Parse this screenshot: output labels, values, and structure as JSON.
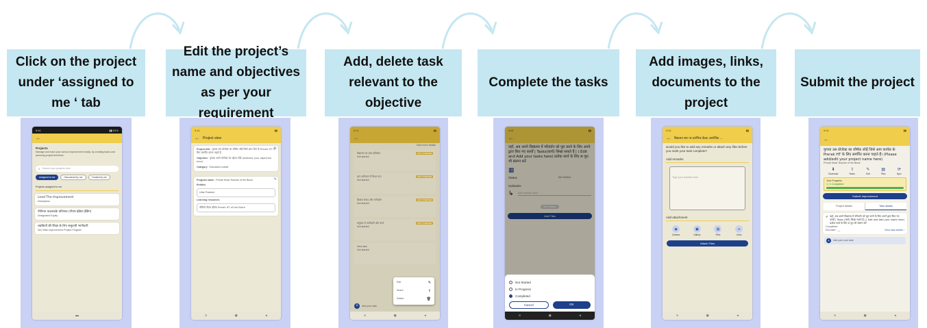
{
  "steps": [
    {
      "caption": "Click on the project under ‘assigned to me ‘ tab"
    },
    {
      "caption": "Edit the project’s name and objectives as per your requirement"
    },
    {
      "caption": "Add, delete task relevant to the objective"
    },
    {
      "caption": "Complete the tasks"
    },
    {
      "caption": "Add images, links, documents to the project"
    },
    {
      "caption": "Submit the project"
    }
  ],
  "colors": {
    "caption_bg": "#c4e7f1",
    "column_bg": "#c9d1f4",
    "appbar": "#f0cd4a",
    "primary": "#1e3f8a",
    "arrow": "#c4e7f1"
  },
  "s1": {
    "title": "Projects",
    "desc": "Manage and track your school improvement easily, by creating tasks and planning project timelines.",
    "search_placeholder": "Search your projects here",
    "tabs": [
      "Assigned to me",
      "Discovered by me",
      "Created by me"
    ],
    "section": "Projects assigned to me",
    "items": [
      {
        "name": "Lead The Improvement",
        "sub": "Description"
      },
      {
        "name": "नीतिगत बदलावके प्रतिभाव (पीएम इंडिया हैडिंग)",
        "sub": "Designated Equity"
      },
      {
        "name": "लड़कियों की शिक्षा के लिए समुदायी भागीदारी",
        "sub": "Sex Wise Improvement Project Program"
      }
    ]
  },
  "s2": {
    "appbar_title": "Project view",
    "title_label": "Project title",
    "title_value": "कृपया उस प्रोजेक्ट का शीर्षक जोड़ें जिसे आप मेंटर के Prerak HT के लिए समर्पित करना चाहते हैं",
    "obj_label": "Objective",
    "obj_value": "कृपया अपने प्रोजेक्ट का उद्देश्य जोड़ें (Address your objective here)",
    "category_label": "Category",
    "category_value": "Education Leader",
    "program_label": "Program name",
    "program_value": "Prerak Head Teacher of the Block",
    "entities_label": "Entities",
    "entities_value": "Uttar Pradesh",
    "resources_label": "Learning resources",
    "resources_value": "वीडियो पीएम इंडिया Prerak HT of the Block"
  },
  "s3": {
    "more": "View more details",
    "badge": "NOT STARTED",
    "tasks": [
      {
        "text": "विद्यालय का शोध प्रतिवेदन",
        "sub": "Not started"
      },
      {
        "text": "ज्ञान अभियान में मिशन रूप",
        "sub": "Not started"
      },
      {
        "text": "शिक्षक संवाद और मार्गदर्शन",
        "sub": "Not started"
      },
      {
        "text": "समुदाय में भागीदारी और कार्य",
        "sub": "Not started"
      },
      {
        "text": "New task",
        "sub": "Not started"
      }
    ],
    "menu": [
      {
        "label": "Edit",
        "icon": "✎"
      },
      {
        "label": "Share",
        "icon": "⇪"
      },
      {
        "label": "Delete",
        "icon": "🗑"
      }
    ],
    "add_label": "Add your task"
  },
  "s4": {
    "heading": "यहाँ, अब अपने विद्यालय में परिवर्तन को पूरा करने के लिए अपने द्वारा किए गए कार्यों | Tasks(कार्य) लिखा सकते हैं | ( Edit and Add your tasks here) प्रत्येक कार्य के लिए स पूरा भी संलग्न करें",
    "status_label": "Status",
    "status_value": "Not Started",
    "subtasks_label": "Subtasks",
    "subtask_placeholder": "Add subtask name",
    "add_subtask": "Add subtask",
    "add_files": "Add Files",
    "options": [
      "Not Started",
      "In Progress",
      "Completed"
    ],
    "selected": 2,
    "cancel": "Cancel",
    "ok": "OK"
  },
  "s5": {
    "appbar_title": "विद्यालय स्तर पर प्रारंभिक बैठक आयोजित ...",
    "question": "would you like to add any remarks or attach any files before you mark your task complete?",
    "remarks_label": "Add remarks",
    "remarks_placeholder": "Type your remarks here",
    "attach_label": "Add attachment",
    "icons": [
      {
        "label": "Camera",
        "icon": "◉"
      },
      {
        "label": "Gallery",
        "icon": "▣"
      },
      {
        "label": "Files",
        "icon": "▤"
      },
      {
        "label": "Links",
        "icon": "∞"
      }
    ],
    "attach_button": "Attach Files"
  },
  "s6": {
    "title": "कृपया उस प्रोजेक्ट का शीर्षक जोड़ें जिसे आप कार्यक के Prerak HT के लिए समर्पित करना चाहते हैं। (Please add/edit your project name here)",
    "sub": "Prerak Head Teacher of the Block",
    "actions": [
      {
        "label": "Download",
        "icon": "⬇"
      },
      {
        "label": "Share",
        "icon": "⇪"
      },
      {
        "label": "Edit",
        "icon": "✎"
      },
      {
        "label": "Files",
        "icon": "▤"
      },
      {
        "label": "Sync",
        "icon": "⟳"
      }
    ],
    "progress_label": "Your Progress",
    "progress_text": "1 / 1 Completed",
    "progress": 1.0,
    "submit": "Submit Improvement",
    "tabs": [
      "Project details",
      "Task details"
    ],
    "task_text": "यहाँ, अब अपने विद्यालय में परिवर्तन को पूरा करने के लिए अपने द्वारा किए गए कार्यों | Tasks (कार्य) लिखा सकते हैं | ( Edit and Add your tasks here) प्रत्येक कार्य के लिए स पूरा भी संलग्न करें",
    "task_status": "Completed",
    "end_date": "End date : __",
    "view_task": "View task details ›",
    "add_task": "Add your own task"
  }
}
